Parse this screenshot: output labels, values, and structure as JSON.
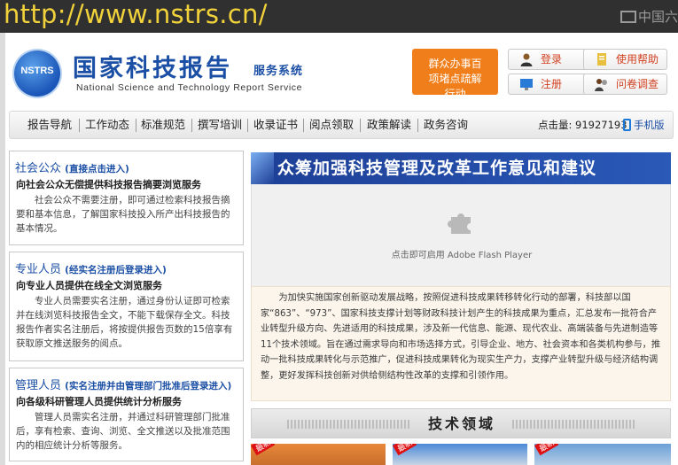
{
  "overlay": {
    "url": "http://www.nstrs.cn/",
    "watermark": "中国六"
  },
  "header": {
    "logo_text": "NSTRS",
    "title": "国家科技报告",
    "subtitle": "服务系统",
    "title_en": "National Science and Technology Report Service",
    "orange_button": "群众办事百项堵点疏解行动",
    "login": "登录",
    "help": "使用帮助",
    "register": "注册",
    "survey": "问卷调查"
  },
  "nav": {
    "items": [
      "报告导航",
      "工作动态",
      "标准规范",
      "撰写培训",
      "收录证书",
      "阅点领取",
      "政策解读",
      "政务咨询"
    ],
    "hits_label": "点击量:",
    "hits_value": "91927193",
    "mobile": "手机版"
  },
  "left": {
    "public": {
      "title": "社会公众",
      "note": "(直接点击进入)",
      "sub": "向社会公众无偿提供科技报告摘要浏览服务",
      "text": "社会公众不需要注册，即可通过检索科技报告摘要和基本信息，了解国家科技投入所产出科技报告的基本情况。"
    },
    "pro": {
      "title": "专业人员",
      "note": "(经实名注册后登录进入)",
      "sub": "向专业人员提供在线全文浏览服务",
      "text": "专业人员需要实名注册，通过身份认证即可检索并在线浏览科技报告全文，不能下载保存全文。科技报告作者实名注册后，将按提供报告页数的15倍享有获取原文推送服务的阅点。"
    },
    "admin": {
      "title": "管理人员",
      "note": "(实名注册并由管理部门批准后登录进入)",
      "sub": "向各级科研管理人员提供统计分析服务",
      "text": "管理人员需实名注册，并通过科研管理部门批准后，享有检索、查询、浏览、全文推送以及批准范围内的相应统计分析等服务。"
    }
  },
  "main": {
    "banner_title": "众筹加强科技管理及改革工作意见和建议",
    "flash_msg": "点击即可启用 Adobe Flash Player",
    "article": "为加快实施国家创新驱动发展战略，按照促进科技成果转移转化行动的部署，科技部以国家“863”、“973”、国家科技支撑计划等财政科技计划产生的科技成果为重点，汇总发布一批符合产业转型升级方向、先进适用的科技成果，涉及新一代信息、能源、现代农业、高端装备与先进制造等11个技术领域。旨在通过需求导向和市场选择方式，引导企业、地方、社会资本和各类机构参与，推动一批科技成果转化与示范推广，促进科技成果转化为现实生产力，支撑产业转型升级与经济结构调整，更好发挥科技创新对供给侧结构性改革的支撑和引领作用。",
    "tech_title": "技术领域",
    "thumb_tag": "最新"
  },
  "colors": {
    "brand_blue": "#1b4fa5",
    "orange": "#f07e1a",
    "url_yellow": "#f2d23a"
  }
}
